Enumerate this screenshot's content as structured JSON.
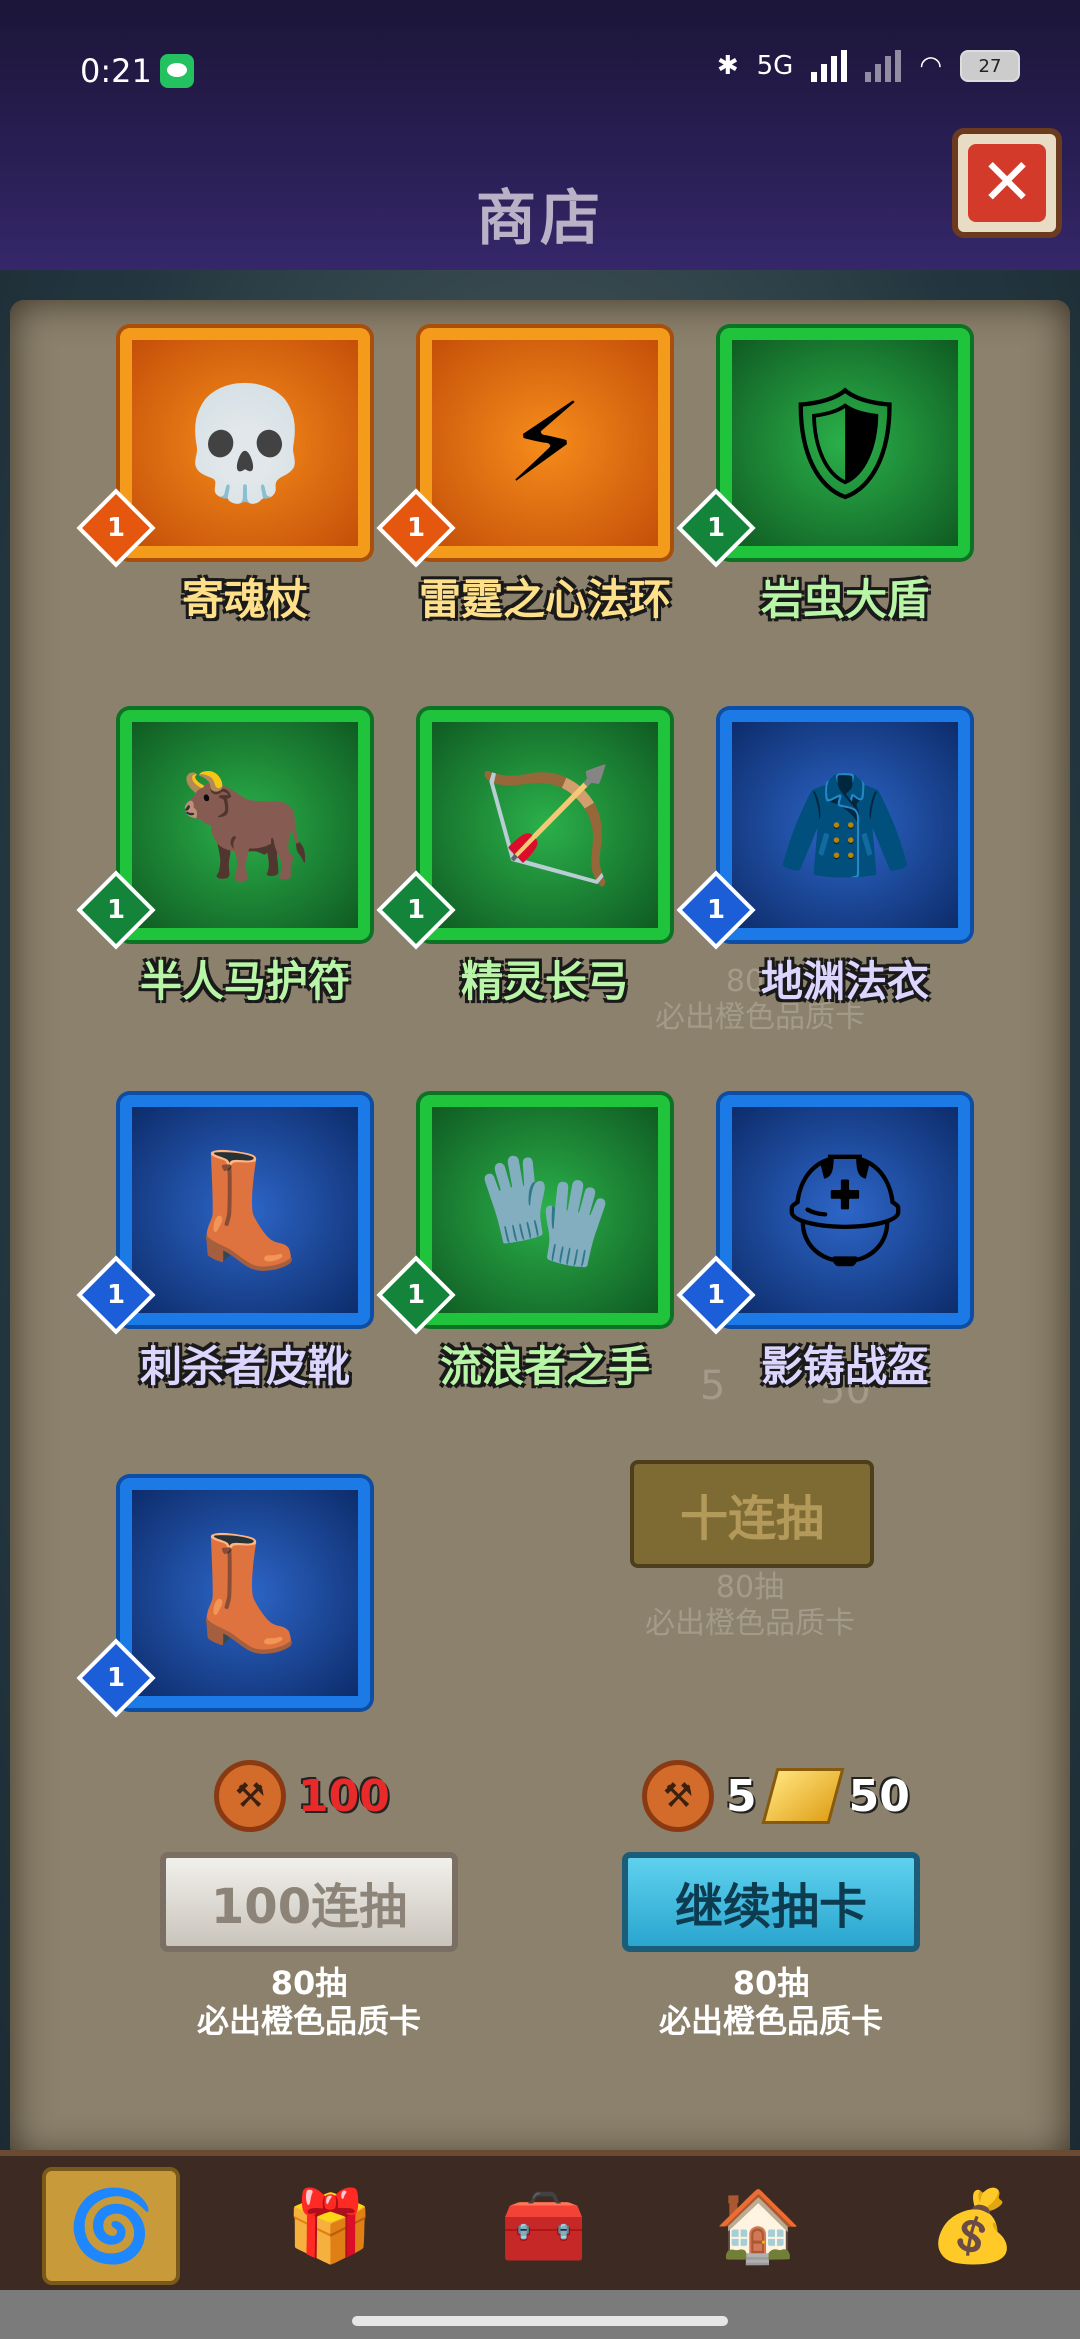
{
  "status_bar": {
    "time": "0:21",
    "network": "5G",
    "battery": "27"
  },
  "header": {
    "title": "商店"
  },
  "cards": [
    {
      "name": "寄魂杖",
      "level": "1",
      "rarity": "orange",
      "icon": "skull-staff-icon",
      "glyph": "💀"
    },
    {
      "name": "雷霆之心法环",
      "level": "1",
      "rarity": "orange",
      "icon": "lightning-amulet-icon",
      "glyph": "⚡"
    },
    {
      "name": "岩虫大盾",
      "level": "1",
      "rarity": "green",
      "icon": "spiked-shield-icon",
      "glyph": "🛡"
    },
    {
      "name": "半人马护符",
      "level": "1",
      "rarity": "green",
      "icon": "centaur-amulet-icon",
      "glyph": "🐂"
    },
    {
      "name": "精灵长弓",
      "level": "1",
      "rarity": "green",
      "icon": "elven-bow-icon",
      "glyph": "🏹"
    },
    {
      "name": "地渊法衣",
      "level": "1",
      "rarity": "blue",
      "icon": "robe-icon",
      "glyph": "🧥"
    },
    {
      "name": "刺杀者皮靴",
      "level": "1",
      "rarity": "blue",
      "icon": "leather-boots-icon",
      "glyph": "👢"
    },
    {
      "name": "流浪者之手",
      "level": "1",
      "rarity": "green",
      "icon": "gauntlet-icon",
      "glyph": "🧤"
    },
    {
      "name": "影铸战盔",
      "level": "1",
      "rarity": "blue",
      "icon": "horned-helmet-icon",
      "glyph": "⛑"
    },
    {
      "name": "",
      "level": "1",
      "rarity": "blue",
      "icon": "iron-boots-icon",
      "glyph": "👢"
    }
  ],
  "background": {
    "ghost_button": "十连抽",
    "ghost_note_1": "80抽",
    "ghost_note_2": "必出橙色品质卡",
    "ghost_cost_a": "5",
    "ghost_cost_b": "50",
    "ghost_row_1": "80抽",
    "ghost_row_2": "必出橙色品质卡"
  },
  "draw_left": {
    "cost": "100",
    "button": "100连抽",
    "note_1": "80抽",
    "note_2": "必出橙色品质卡"
  },
  "draw_right": {
    "cost_anvil": "5",
    "cost_gold": "50",
    "button": "继续抽卡",
    "note_1": "80抽",
    "note_2": "必出橙色品质卡"
  },
  "nav": [
    {
      "icon": "card-deck-icon",
      "glyph": "🌀",
      "active": true
    },
    {
      "icon": "gift-box-icon",
      "glyph": "🎁",
      "active": false
    },
    {
      "icon": "treasure-chest-icon",
      "glyph": "🧰",
      "active": false
    },
    {
      "icon": "tavern-icon",
      "glyph": "🏠",
      "active": false
    },
    {
      "icon": "gold-bag-icon",
      "glyph": "💰",
      "active": false
    }
  ]
}
